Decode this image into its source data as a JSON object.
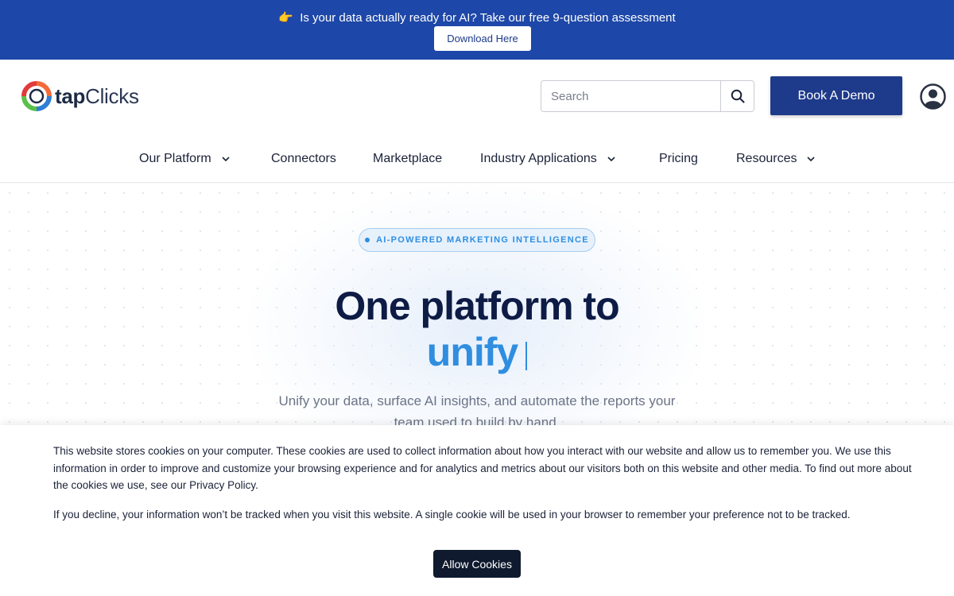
{
  "announcement": {
    "emoji": "👉",
    "text": "Is your data actually ready for AI? Take our free 9-question assessment",
    "button_label": "Download Here"
  },
  "header": {
    "logo": {
      "part1": "tap",
      "part2": "Clicks"
    },
    "search": {
      "placeholder": "Search",
      "value": ""
    },
    "demo_button": "Book A Demo",
    "avatar_icon": "user-circle-icon"
  },
  "nav": {
    "items": [
      {
        "label": "Our Platform",
        "has_dropdown": true
      },
      {
        "label": "Connectors",
        "has_dropdown": false
      },
      {
        "label": "Marketplace",
        "has_dropdown": false
      },
      {
        "label": "Industry Applications",
        "has_dropdown": true
      },
      {
        "label": "Pricing",
        "has_dropdown": false
      },
      {
        "label": "Resources",
        "has_dropdown": true
      }
    ]
  },
  "hero": {
    "badge": "AI-POWERED MARKETING INTELLIGENCE",
    "title": "One platform to",
    "rotating_word": "unify",
    "subtitle": "Unify your data, surface AI insights, and automate the reports your team used to build by hand."
  },
  "cookie": {
    "paragraph1": "This website stores cookies on your computer. These cookies are used to collect information about how you interact with our website and allow us to remember you. We use this information in order to improve and customize your browsing experience and for analytics and metrics about our visitors both on this website and other media. To find out more about the cookies we use, see our Privacy Policy.",
    "paragraph2": "If you decline, your information won’t be tracked when you visit this website. A single cookie will be used in your browser to remember your preference not to be tracked.",
    "button_label": "Allow Cookies"
  },
  "colors": {
    "announcement_bg": "#1d47a8",
    "brand_navy": "#1e3a8a",
    "accent_blue": "#2f8ee0",
    "title_navy": "#0d1b45"
  }
}
